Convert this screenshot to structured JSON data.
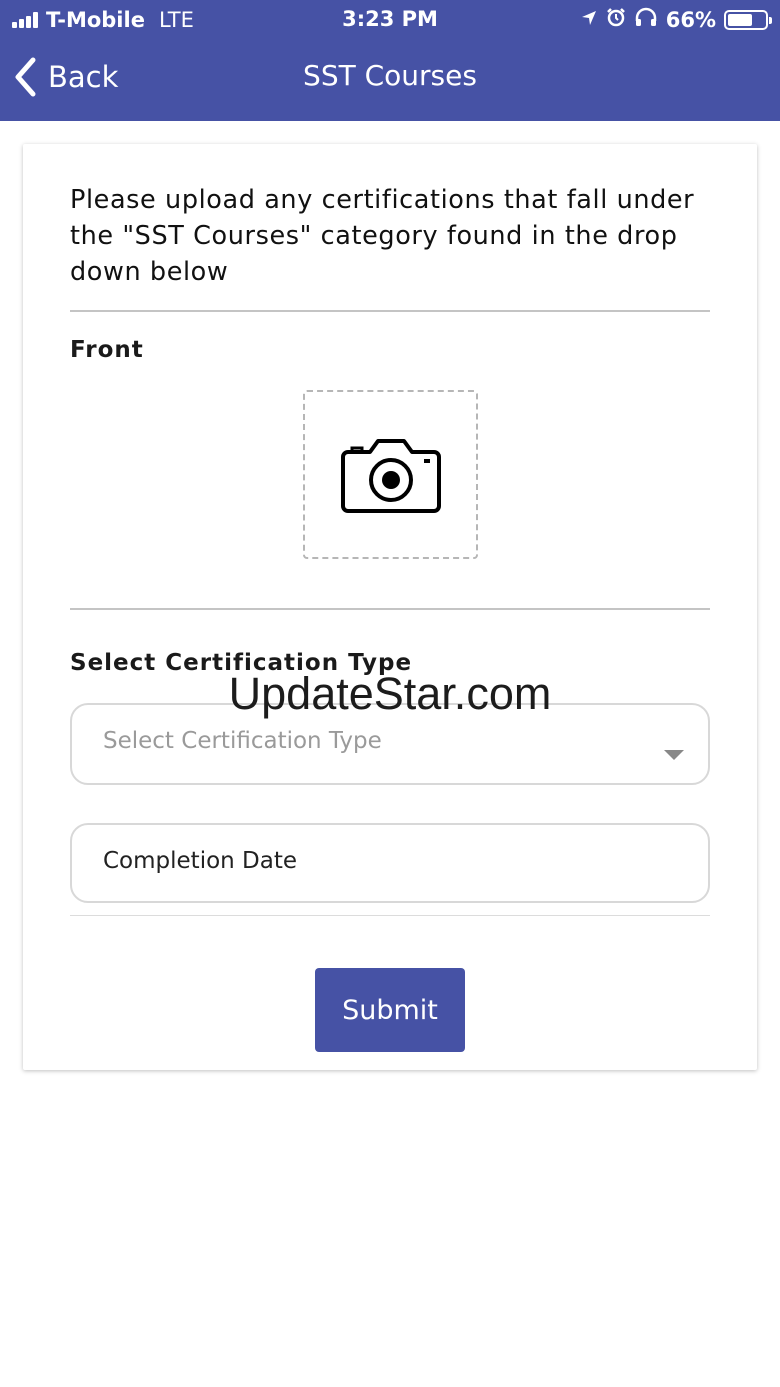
{
  "status_bar": {
    "carrier": "T-Mobile",
    "network": "LTE",
    "time": "3:23 PM",
    "battery": "66%",
    "battery_level": 0.66
  },
  "nav": {
    "back_label": "Back",
    "title": "SST Courses"
  },
  "form": {
    "intro": "Please upload any certifications that fall under the \"SST Courses\" category found in the drop down below",
    "front_label": "Front",
    "cert_type_label": "Select Certification Type",
    "cert_type_placeholder": "Select Certification Type",
    "completion_date_placeholder": "Completion Date",
    "submit_label": "Submit"
  },
  "watermark": "UpdateStar.com",
  "colors": {
    "brand": "#4652a5",
    "placeholder": "#9a9a9a",
    "divider": "#c4c4c4"
  }
}
